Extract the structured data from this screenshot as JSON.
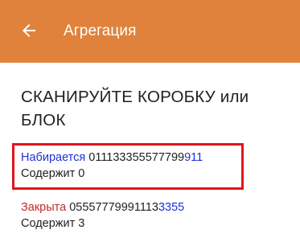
{
  "header": {
    "title": "Агрегация",
    "back_icon": "arrow-left-icon",
    "background": "#e0823c"
  },
  "prompt": {
    "line1": "СКАНИРУЙТЕ КОРОБКУ или",
    "line2": "БЛОК"
  },
  "items": [
    {
      "status": "Набирается",
      "status_color": "#1f2fd6",
      "code_prefix": "011133355577799",
      "code_suffix": "911",
      "contains": "Содержит 0",
      "highlighted": true
    },
    {
      "status": "Закрыта",
      "status_color": "#c62828",
      "code_prefix": "05557779991113",
      "code_suffix": "3355",
      "contains": "Содержит 3",
      "highlighted": false
    }
  ]
}
